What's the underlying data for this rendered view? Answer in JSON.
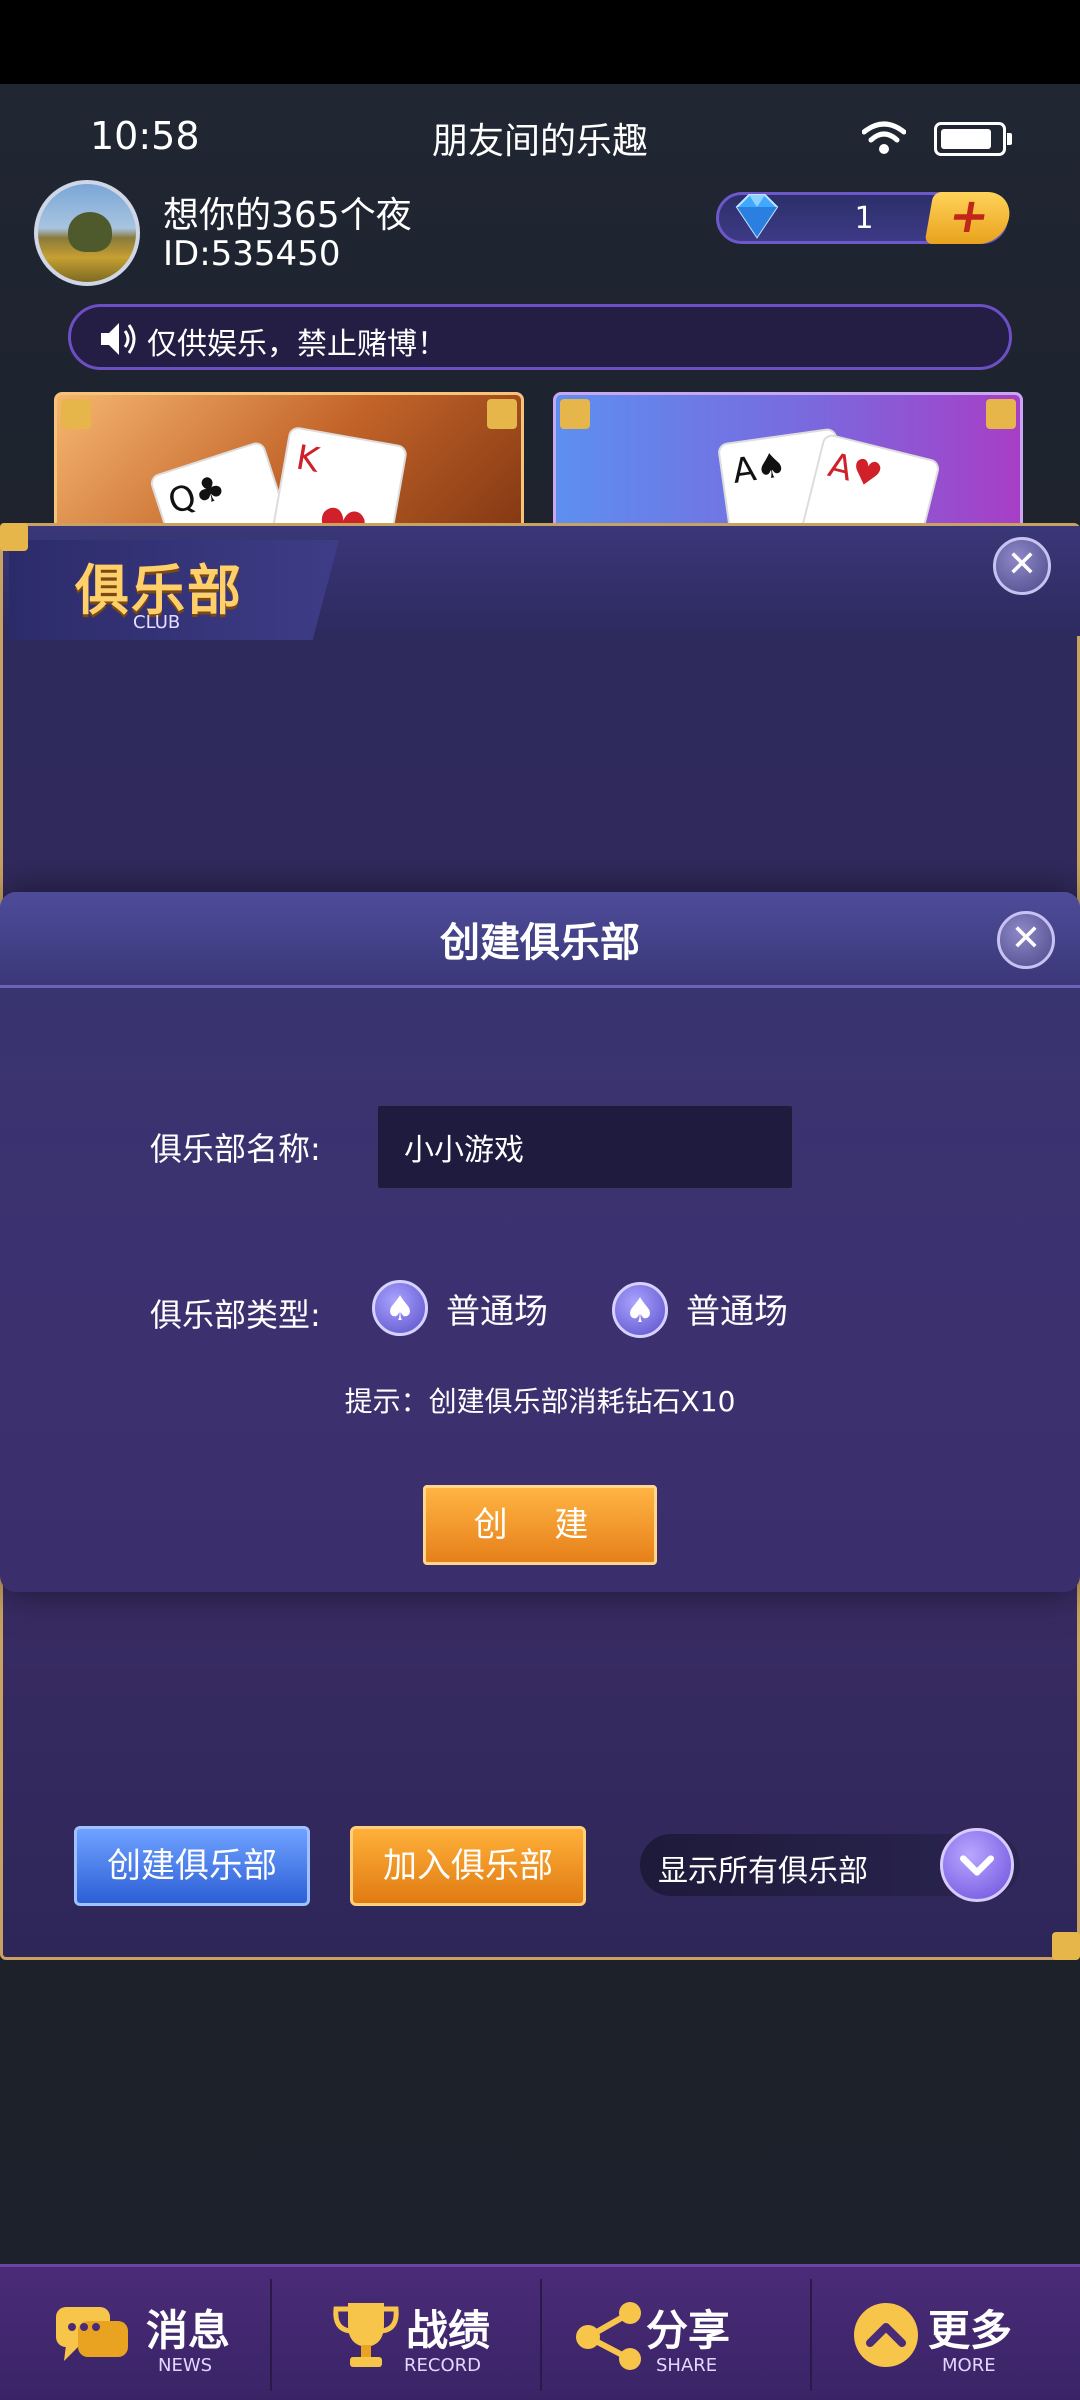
{
  "status_bar": {
    "time": "10:58",
    "title": "朋友间的乐趣"
  },
  "profile": {
    "username": "想你的365个夜",
    "user_id": "ID:535450"
  },
  "gems": {
    "count": "1",
    "plus": "+"
  },
  "notice": {
    "text": "仅供娱乐，禁止赌博！"
  },
  "club_panel": {
    "title": "俱乐部",
    "subtitle": "CLUB",
    "close": "✕",
    "create_club_label": "创建俱乐部",
    "join_club_label": "加入俱乐部",
    "filter_value": "显示所有俱乐部"
  },
  "create_dialog": {
    "title": "创建俱乐部",
    "close": "✕",
    "name_label": "俱乐部名称:",
    "name_value": "小小游戏",
    "type_label": "俱乐部类型:",
    "type_options": [
      "普通场",
      "普通场"
    ],
    "hint": "提示：创建俱乐部消耗钻石X10",
    "create_button": "创 建"
  },
  "bottom_nav": [
    {
      "label": "消息",
      "sub": "NEWS",
      "icon": "chat-icon"
    },
    {
      "label": "战绩",
      "sub": "RECORD",
      "icon": "trophy-icon"
    },
    {
      "label": "分享",
      "sub": "SHARE",
      "icon": "share-icon"
    },
    {
      "label": "更多",
      "sub": "MORE",
      "icon": "chevron-up-icon"
    }
  ],
  "colors": {
    "gold": "#ffcf6a",
    "purple_panel": "#3a2d66",
    "blue_button": "#2d5fd6",
    "orange_button": "#e07b12"
  }
}
